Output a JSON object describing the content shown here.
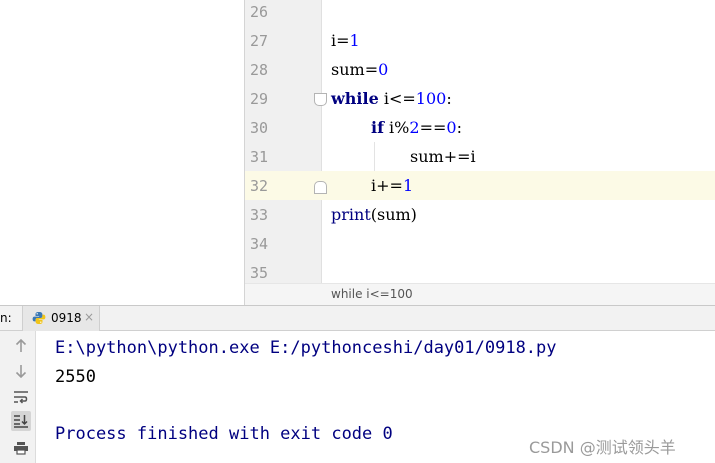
{
  "editor": {
    "lines": [
      {
        "num": "26",
        "code": ""
      },
      {
        "num": "27",
        "code": "i=1"
      },
      {
        "num": "28",
        "code": "sum=0"
      },
      {
        "num": "29",
        "code": "while i<=100:"
      },
      {
        "num": "30",
        "code": "if i%2==0:"
      },
      {
        "num": "31",
        "code": "sum+=i"
      },
      {
        "num": "32",
        "code": "i+=1"
      },
      {
        "num": "33",
        "code": "print(sum)"
      },
      {
        "num": "34",
        "code": ""
      },
      {
        "num": "35",
        "code": ""
      }
    ],
    "tokens": {
      "l27_var": "i",
      "l27_op": "=",
      "l27_num": "1",
      "l28_var": "sum",
      "l28_op": "=",
      "l28_num": "0",
      "l29_kw": "while",
      "l29_rest": " i<=",
      "l29_num": "100",
      "l29_colon": ":",
      "l30_kw": "if",
      "l30_rest": " i%",
      "l30_num1": "2",
      "l30_op": "==",
      "l30_num2": "0",
      "l30_colon": ":",
      "l31_text": "sum+=i",
      "l32_rest": "i+=",
      "l32_num": "1",
      "l33_fn": "print",
      "l33_args": "(sum)"
    },
    "breadcrumb": "while i<=100"
  },
  "run_panel": {
    "label": "n:",
    "tab_label": "0918",
    "tab_close": "×",
    "console": {
      "command": "E:\\python\\python.exe E:/pythonceshi/day01/0918.py",
      "output": "2550",
      "finished": "Process finished with exit code 0"
    },
    "tools": [
      "up-arrow-icon",
      "down-arrow-icon",
      "soft-wrap-icon",
      "scroll-to-end-icon",
      "print-icon"
    ]
  },
  "watermark": "CSDN @测试领头羊",
  "colors": {
    "keyword": "#000080",
    "number": "#0000ff",
    "current_line": "#fcfae6",
    "gutter": "#f0f0f0"
  }
}
